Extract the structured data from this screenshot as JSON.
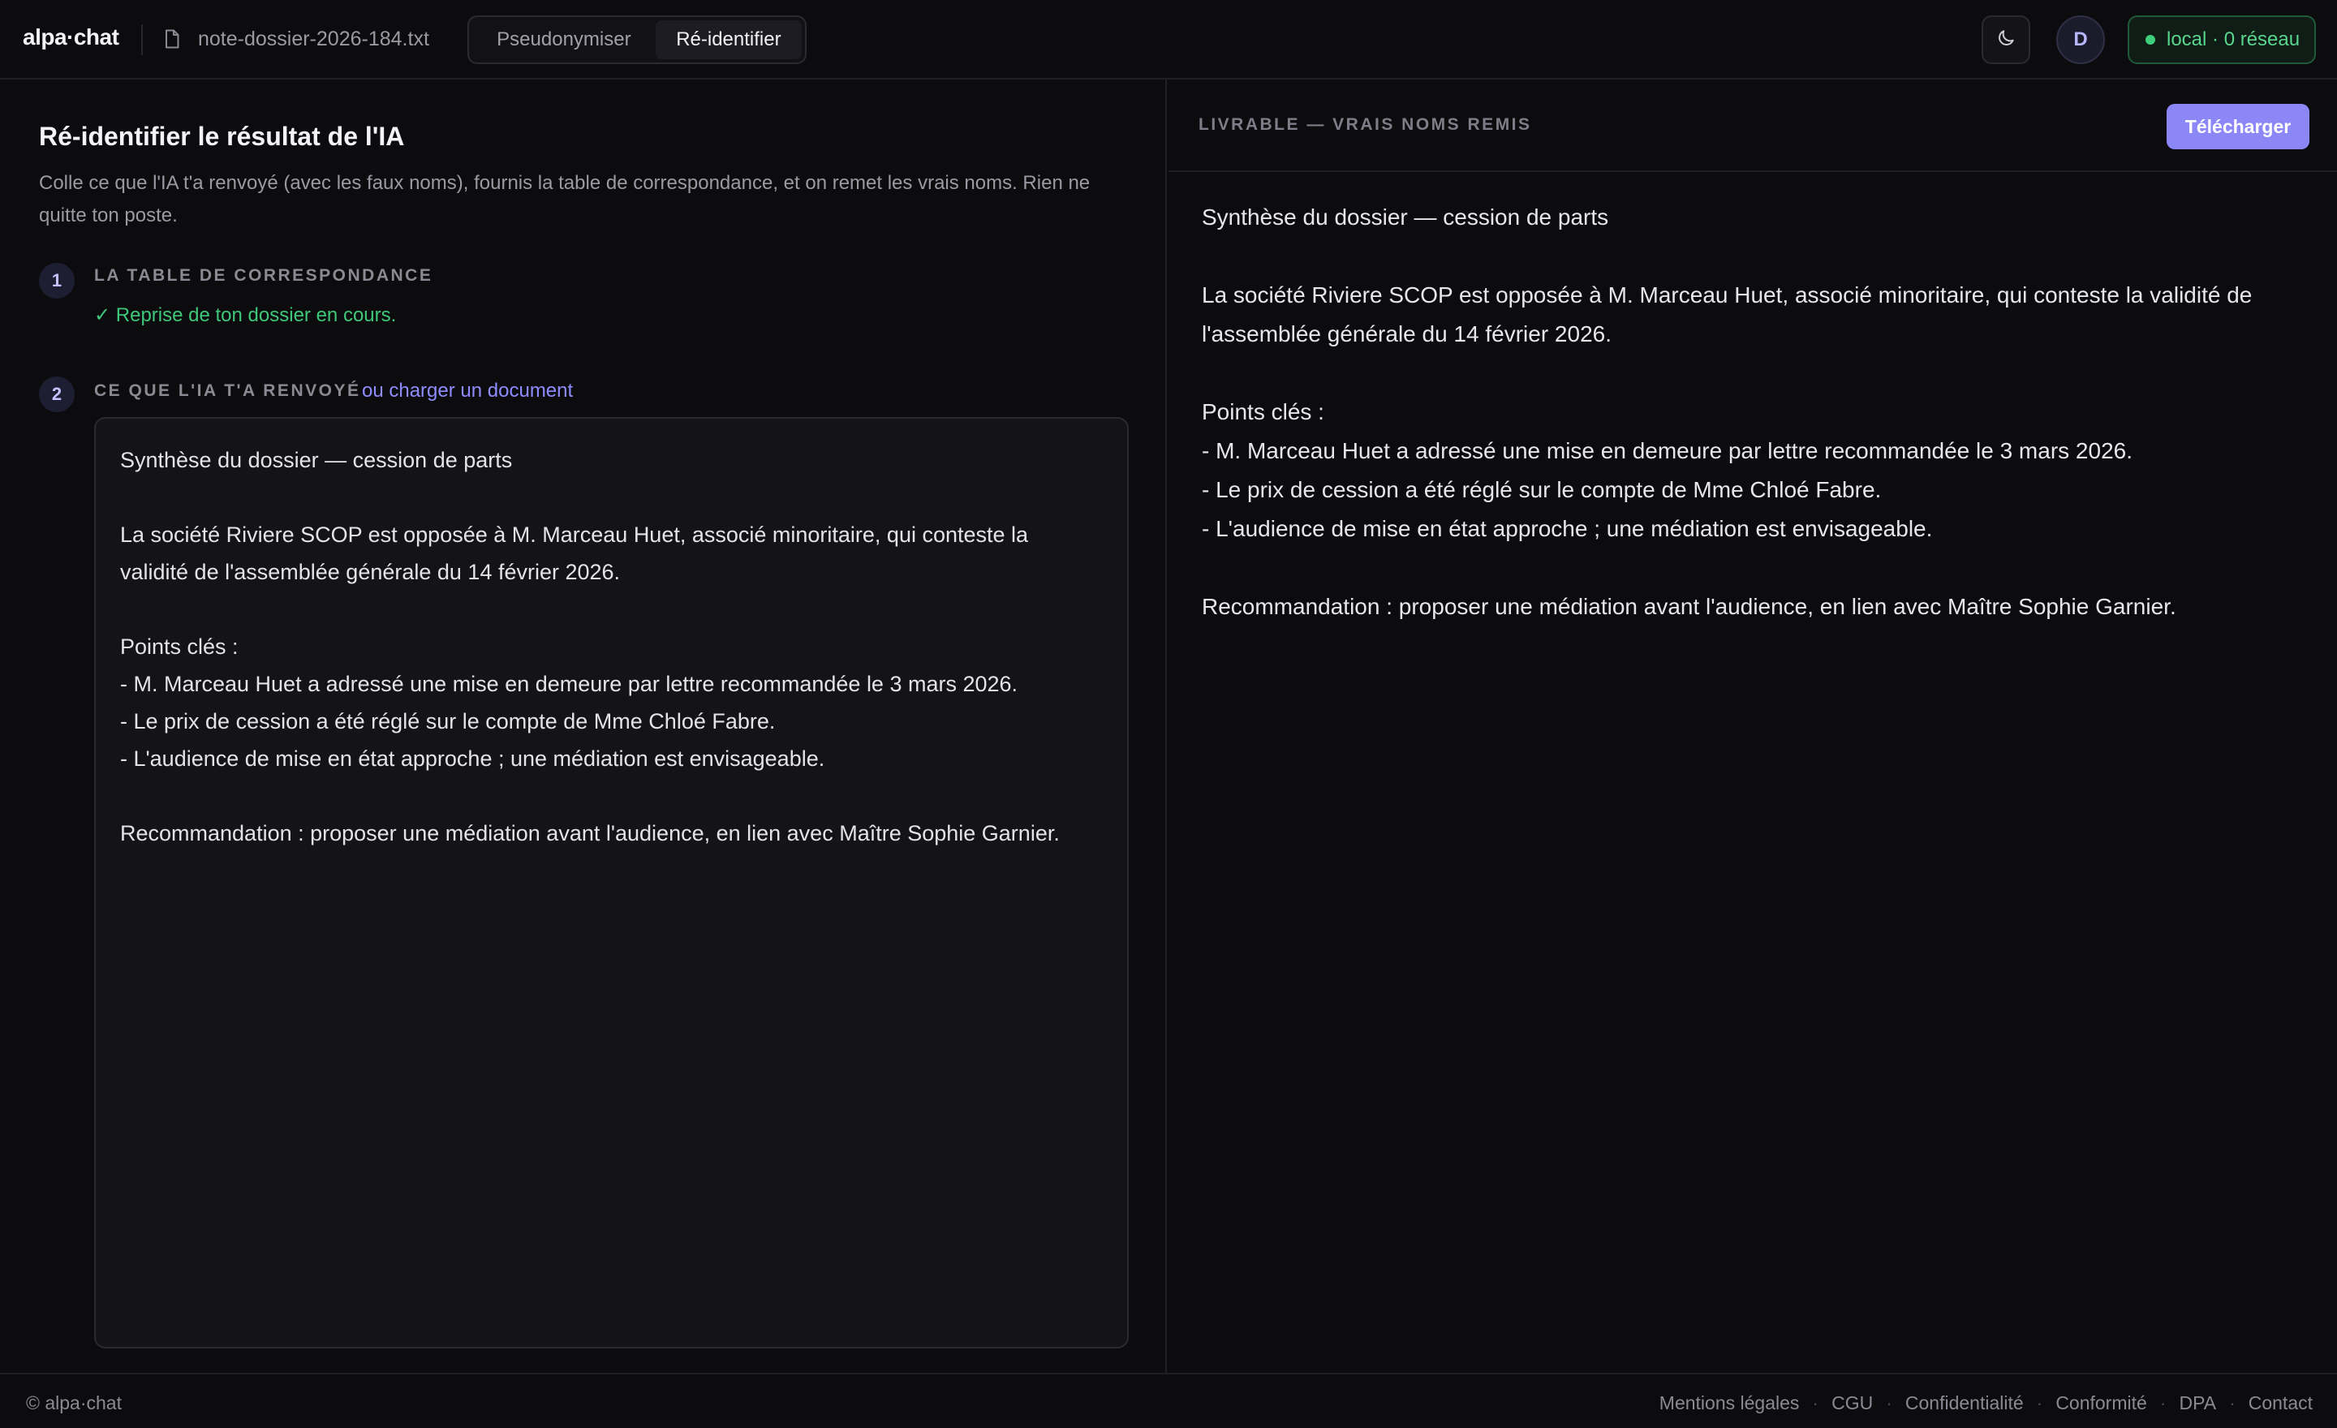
{
  "header": {
    "logo": "alpa·chat",
    "file_name": "note-dossier-2026-184.txt",
    "modes": [
      "Pseudonymiser",
      "Ré-identifier"
    ],
    "active_mode": "Ré-identifier",
    "avatar_initial": "D",
    "network_status": "local · 0 réseau",
    "theme_icon": "moon-icon",
    "file_icon": "file-icon"
  },
  "left": {
    "title": "Ré-identifier le résultat de l'IA",
    "description": "Colle ce que l'IA t'a renvoyé (avec les faux noms), fournis la table de correspondance, et on remet les vrais noms. Rien ne quitte ton poste.",
    "step1": {
      "number": "1",
      "label": "LA TABLE DE CORRESPONDANCE",
      "status": "✓ Reprise de ton dossier en cours."
    },
    "step2": {
      "number": "2",
      "label": "CE QUE L'IA T'A RENVOYÉ",
      "link": "ou charger un document"
    },
    "editor_text": "Synthèse du dossier — cession de parts\n\nLa société Riviere SCOP est opposée à M. Marceau Huet, associé minoritaire, qui conteste la\nvalidité de l'assemblée générale du 14 février 2026.\n\nPoints clés :\n- M. Marceau Huet a adressé une mise en demeure par lettre recommandée le 3 mars 2026.\n- Le prix de cession a été réglé sur le compte de Mme Chloé Fabre.\n- L'audience de mise en état approche ; une médiation est envisageable.\n\nRecommandation : proposer une médiation avant l'audience, en lien avec Maître Sophie Garnier."
  },
  "right": {
    "label": "LIVRABLE — VRAIS NOMS REMIS",
    "download_label": "Télécharger",
    "output_text": "Synthèse du dossier — cession de parts\n\nLa société Riviere SCOP est opposée à M. Marceau Huet, associé minoritaire, qui conteste la validité de\nl'assemblée générale du 14 février 2026.\n\nPoints clés :\n- M. Marceau Huet a adressé une mise en demeure par lettre recommandée le 3 mars 2026.\n- Le prix de cession a été réglé sur le compte de Mme Chloé Fabre.\n- L'audience de mise en état approche ; une médiation est envisageable.\n\nRecommandation : proposer une médiation avant l'audience, en lien avec Maître Sophie Garnier."
  },
  "footer": {
    "copyright": "© alpa·chat",
    "links": [
      "Mentions légales",
      "CGU",
      "Confidentialité",
      "Conformité",
      "DPA",
      "Contact"
    ]
  },
  "colors": {
    "accent": "#8b87f7",
    "success": "#3fc77a",
    "background": "#0c0c0f"
  }
}
